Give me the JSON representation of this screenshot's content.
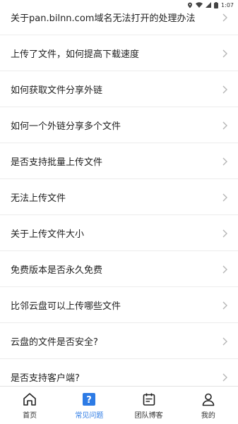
{
  "status_bar": {
    "time": "1:07"
  },
  "faq": {
    "items": [
      {
        "label": "关于pan.bilnn.com域名无法打开的处理办法"
      },
      {
        "label": "上传了文件，如何提高下载速度"
      },
      {
        "label": "如何获取文件分享外链"
      },
      {
        "label": "如何一个外链分享多个文件"
      },
      {
        "label": "是否支持批量上传文件"
      },
      {
        "label": "无法上传文件"
      },
      {
        "label": "关于上传文件大小"
      },
      {
        "label": "免费版本是否永久免费"
      },
      {
        "label": "比邻云盘可以上传哪些文件"
      },
      {
        "label": "云盘的文件是否安全?"
      },
      {
        "label": "是否支持客户端?"
      }
    ]
  },
  "tab_bar": {
    "tabs": [
      {
        "label": "首页",
        "icon": "home-icon"
      },
      {
        "label": "常见问题",
        "icon": "question-icon",
        "active": true
      },
      {
        "label": "团队博客",
        "icon": "calendar-icon"
      },
      {
        "label": "我的",
        "icon": "user-icon"
      }
    ]
  },
  "colors": {
    "accent": "#2d7be5",
    "divider": "#ececec",
    "chevron": "#b5b5b5"
  }
}
